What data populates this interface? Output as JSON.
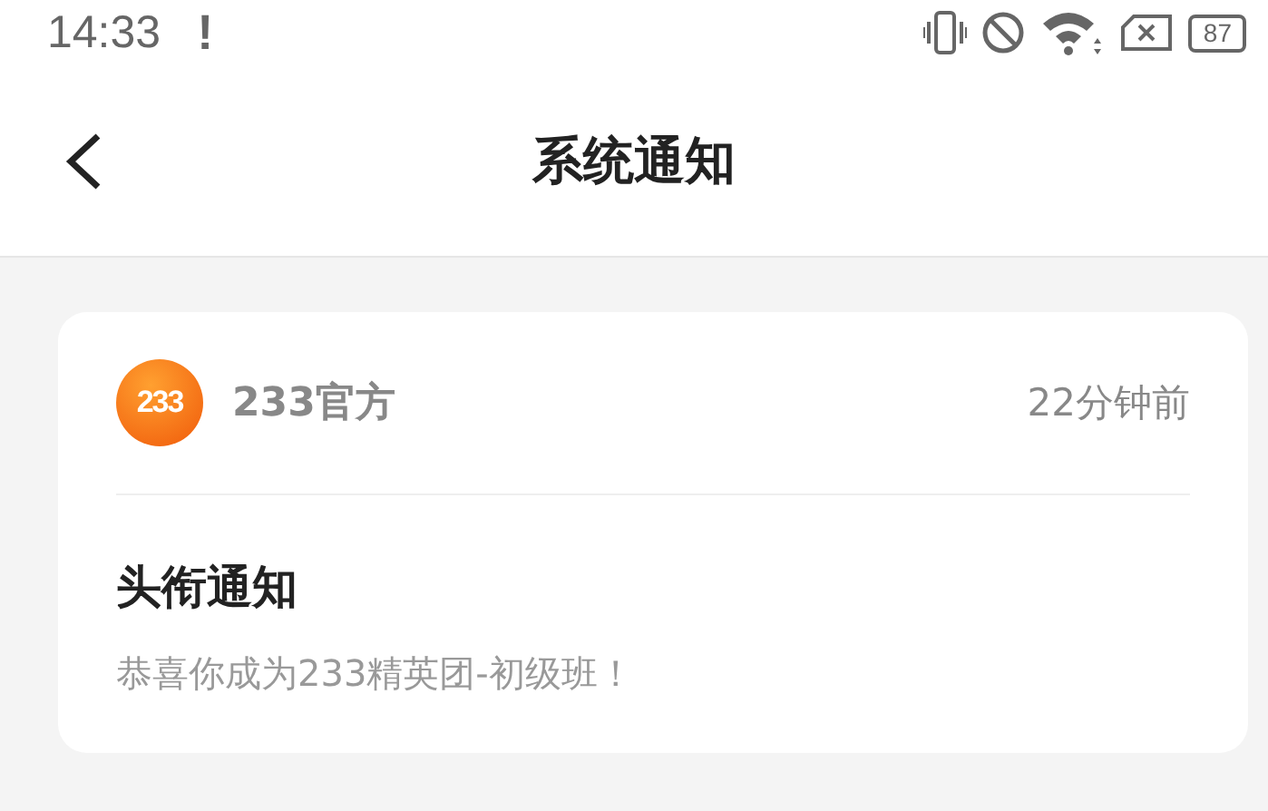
{
  "status_bar": {
    "time": "14:33",
    "alert": "!",
    "battery": "87"
  },
  "header": {
    "title": "系统通知"
  },
  "notices": [
    {
      "logo": "233",
      "sender": "233官方",
      "time": "22分钟前",
      "title": "头衔通知",
      "body": "恭喜你成为233精英团-初级班！"
    }
  ]
}
